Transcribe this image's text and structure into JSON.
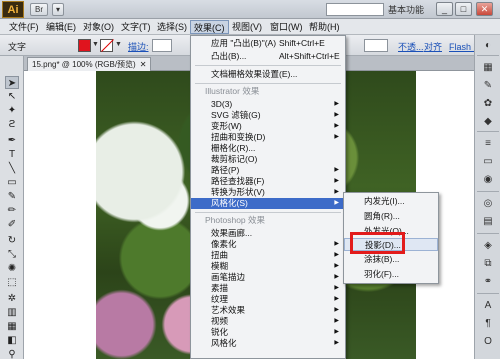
{
  "app": {
    "logo": "Ai",
    "title_buttons": [
      "Br",
      "▾"
    ],
    "workspace": "基本功能",
    "window_controls": [
      "_",
      "□",
      "✕"
    ]
  },
  "menubar": {
    "items": [
      "文件(F)",
      "编辑(E)",
      "对象(O)",
      "文字(T)",
      "选择(S)",
      "效果(C)",
      "视图(V)",
      "窗口(W)",
      "帮助(H)"
    ],
    "active": "效果(C)"
  },
  "controlbar": {
    "selection_label": "文字",
    "fill_color": "#e0141e",
    "stroke_label": "描边:",
    "opacity_label": "不透...",
    "align_label": "对齐",
    "flash_label": "Flash 文本"
  },
  "document": {
    "tab_label": "15.png* @ 100% (RGB/预览)",
    "close_glyph": "✕"
  },
  "effect_menu": {
    "apply_label": "应用 \"凸出(B)\"(A)",
    "apply_shortcut": "Shift+Ctrl+E",
    "convex_label": "凸出(B)...",
    "convex_shortcut": "Alt+Shift+Ctrl+E",
    "raster_settings": "文档栅格效果设置(E)...",
    "illustrator_section": "Illustrator 效果",
    "illustrator_items": [
      "3D(3)",
      "SVG 滤镜(G)",
      "变形(W)",
      "扭曲和变换(D)",
      "栅格化(R)...",
      "裁剪标记(O)",
      "路径(P)",
      "路径查找器(F)",
      "转换为形状(V)",
      "风格化(S)"
    ],
    "photoshop_section": "Photoshop 效果",
    "photoshop_items": [
      "效果画廊...",
      "像素化",
      "扭曲",
      "模糊",
      "画笔描边",
      "素描",
      "纹理",
      "艺术效果",
      "视频",
      "锐化",
      "风格化"
    ]
  },
  "stylize_submenu": {
    "items": [
      "内发光(I)...",
      "圆角(R)...",
      "外发光(O)...",
      "投影(D)...",
      "涂抹(B)...",
      "羽化(F)..."
    ],
    "highlighted": "投影(D)..."
  },
  "colors": {
    "highlight": "#3d6bc8",
    "annotation_box": "#e21b1b"
  }
}
